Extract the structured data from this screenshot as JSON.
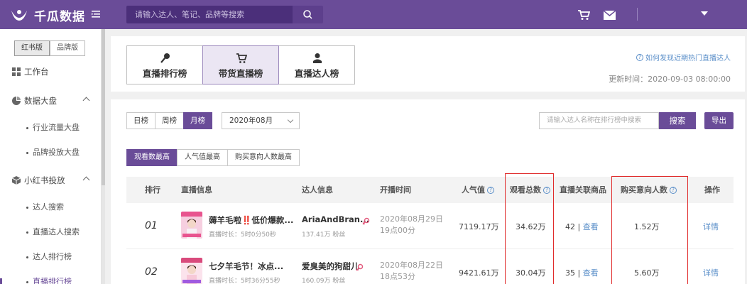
{
  "app": {
    "name": "千瓜数据",
    "search_placeholder": "请输入达人、笔记、品牌等搜索"
  },
  "sidebar": {
    "switch": [
      "红书版",
      "品牌版"
    ],
    "items": [
      {
        "label": "工作台",
        "icon": "grid-icon"
      },
      {
        "label": "数据大盘",
        "icon": "pie-chart-icon",
        "expandable": true
      },
      {
        "label": "小红书投放",
        "icon": "cube-icon",
        "expandable": true
      }
    ],
    "sub_data": [
      "行业流量大盘",
      "品牌投放大盘"
    ],
    "sub_xhs": [
      "达人搜索",
      "直播达人搜索",
      "达人排行榜",
      "直播排行榜"
    ]
  },
  "rank_tabs": [
    "直播排行榜",
    "带货直播榜",
    "直播达人榜"
  ],
  "help_link": "如何发现近期热门直播达人",
  "update_time": "更新时间：2020-09-03 08:00:00",
  "filters": {
    "periods": [
      "日榜",
      "周榜",
      "月榜"
    ],
    "month": "2020年08月",
    "search_placeholder": "请输入达人名称在排行榜中搜索",
    "search_btn": "搜索",
    "export_btn": "导出",
    "sort_tabs": [
      "观看数最高",
      "人气值最高",
      "购买意向人数最高"
    ]
  },
  "table": {
    "headers": {
      "rank": "排行",
      "live_info": "直播信息",
      "talent_info": "达人信息",
      "start_time": "开播时间",
      "popularity": "人气值",
      "views": "观看总数",
      "products": "直播关联商品",
      "buyers": "购买意向人数",
      "action": "操作"
    },
    "rows": [
      {
        "rank": "01",
        "title": "薅羊毛啦‼️低价爆款...",
        "duration": "直播时长：5时0分50秒",
        "talent": "AriaAndBran...",
        "fans": "137.41万 粉丝",
        "time_line1": "2020年08月29日",
        "time_line2": "19点00分",
        "popularity": "7119.17万",
        "views": "34.62万",
        "products_count": "42",
        "products_link": "查看",
        "buyers": "1.52万",
        "action": "详情"
      },
      {
        "rank": "02",
        "title": "七夕羊毛节！冰点...",
        "duration": "直播时长：5时36分55秒",
        "talent": "爱臭美的狗甜儿",
        "fans": "160.09万 粉丝",
        "time_line1": "2020年08月22日",
        "time_line2": "18点53分",
        "popularity": "9421.61万",
        "views": "30.04万",
        "products_count": "35",
        "products_link": "查看",
        "buyers": "5.60万",
        "action": "详情"
      }
    ]
  },
  "colors": {
    "brand": "#6a4c98",
    "link": "#5b8fc9",
    "highlight": "#e02b2b"
  }
}
